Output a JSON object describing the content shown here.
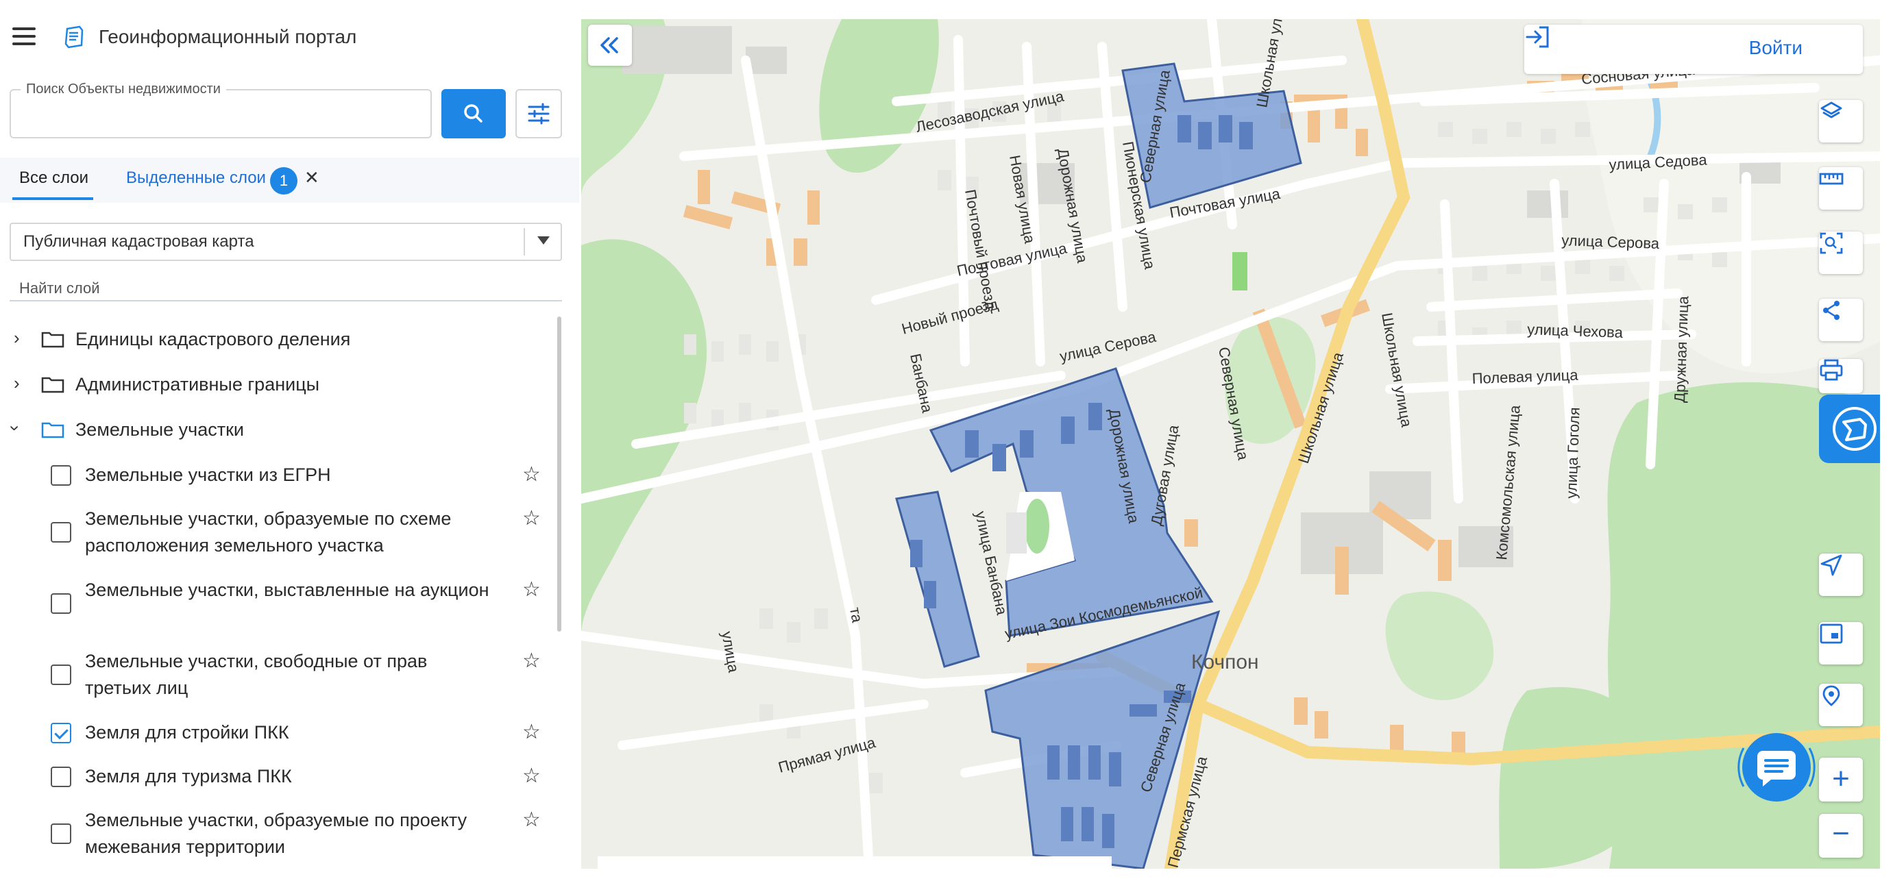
{
  "header": {
    "title": "Геоинформационный портал"
  },
  "search": {
    "label": "Поиск Объекты недвижимости",
    "value": ""
  },
  "tabs": {
    "all": "Все слои",
    "selected": "Выделенные слои",
    "selected_count": "1"
  },
  "basemap": {
    "value": "Публичная кадастровая карта"
  },
  "find_layer": {
    "label": "Найти слой"
  },
  "tree": {
    "folders": [
      {
        "label": "Единицы кадастрового деления"
      },
      {
        "label": "Административные границы"
      },
      {
        "label": "Земельные участки"
      }
    ],
    "items": [
      {
        "label": "Земельные участки из ЕГРН",
        "checked": false
      },
      {
        "label": "Земельные участки, образуемые по схеме расположения земельного участка",
        "checked": false
      },
      {
        "label": "Земельные участки, выставленные на аукцион",
        "checked": false
      },
      {
        "label": "Земельные участки, свободные от прав третьих лиц",
        "checked": false
      },
      {
        "label": "Земля для стройки ПКК",
        "checked": true
      },
      {
        "label": "Земля для туризма ПКК",
        "checked": false
      },
      {
        "label": "Земельные участки, образуемые по проекту межевания территории",
        "checked": false
      }
    ]
  },
  "map": {
    "login_label": "Войти",
    "place_label": "Кочпон",
    "streets": [
      "Лесозаводская улица",
      "Почтовый проезд",
      "Новая улица",
      "Дорожная улица",
      "Пионерская улица",
      "Северная улица",
      "Школьная улица",
      "Сосновая улица",
      "улица Седова",
      "Почтовая улица",
      "Почтовая улица",
      "улица Серова",
      "Новый проезд",
      "улица Серова",
      "Банбана",
      "улица Чехова",
      "Школьная улица",
      "Северная улица",
      "Полевая улица",
      "Дорожная улица",
      "Дуговая улица",
      "улица Банбана",
      "Комсомольская улица",
      "улица Гоголя",
      "Дружная улица",
      "улица Зои Космодемьянской",
      "Школьная улица",
      "Северная улица",
      "Прямая улица",
      "Пермская улица",
      "улица",
      "та"
    ]
  },
  "colors": {
    "accent": "#1e87e5",
    "parcel_fill": "#7d9fd6",
    "parcel_stroke": "#3d5f9e"
  },
  "icons": [
    "menu-icon",
    "portal-logo-icon",
    "search-icon",
    "filter-icon",
    "folder-icon",
    "chevron-right-icon",
    "chevron-down-icon",
    "star-icon",
    "checkbox-icon",
    "collapse-icon",
    "login-icon",
    "layers-icon",
    "ruler-icon",
    "scan-icon",
    "share-icon",
    "print-icon",
    "panel-icon",
    "navigate-icon",
    "minimap-icon",
    "geolocation-icon",
    "chat-icon"
  ]
}
